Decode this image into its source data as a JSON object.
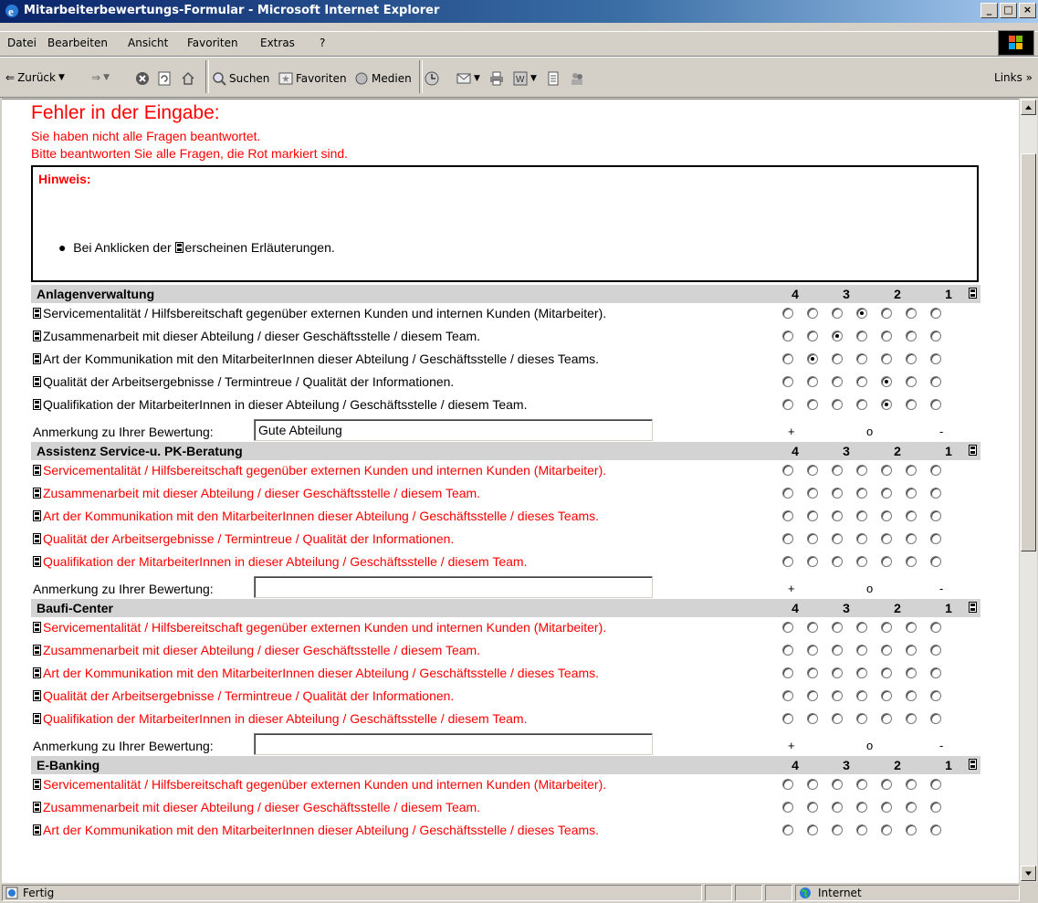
{
  "window": {
    "title": "Mitarbeiterbewertungs-Formular - Microsoft Internet Explorer",
    "min": "_",
    "max": "□",
    "close": "×"
  },
  "menu": [
    "Datei",
    "Bearbeiten",
    "Ansicht",
    "Favoriten",
    "Extras",
    "?"
  ],
  "toolbar": {
    "back": "Zurück",
    "search": "Suchen",
    "favorites": "Favoriten",
    "media": "Medien",
    "links": "Links"
  },
  "error": {
    "title": "Fehler in der Eingabe:",
    "line1": "Sie haben nicht alle Fragen beantwortet.",
    "line2": "Bitte beantworten Sie alle Fragen, die Rot markiert sind."
  },
  "hint": {
    "title": "Hinweis:",
    "bullet_pre": "Bei Anklicken der",
    "bullet_post": "erscheinen Erläuterungen."
  },
  "scale": [
    "4",
    "3",
    "2",
    "1"
  ],
  "remark": {
    "label": "Anmerkung zu Ihrer Bewertung:",
    "plus": "+",
    "zero": "o",
    "minus": "-"
  },
  "sections": [
    {
      "name": "Anlagenverwaltung",
      "remark_value": "Gute Abteilung",
      "questions": [
        {
          "text": "Servicementalität / Hilfsbereitschaft gegenüber externen Kunden und internen Kunden (Mitarbeiter).",
          "missing": false,
          "selected": 3
        },
        {
          "text": "Zusammenarbeit mit dieser Abteilung / dieser Geschäftsstelle / diesem Team.",
          "missing": false,
          "selected": 2
        },
        {
          "text": "Art der Kommunikation mit den MitarbeiterInnen dieser Abteilung / Geschäftsstelle / dieses Teams.",
          "missing": false,
          "selected": 1
        },
        {
          "text": "Qualität der Arbeitsergebnisse / Termintreue / Qualität der Informationen.",
          "missing": false,
          "selected": 4
        },
        {
          "text": "Qualifikation der MitarbeiterInnen in dieser Abteilung / Geschäftsstelle / diesem Team.",
          "missing": false,
          "selected": 4
        }
      ]
    },
    {
      "name": "Assistenz Service-u. PK-Beratung",
      "remark_value": "",
      "questions": [
        {
          "text": "Servicementalität / Hilfsbereitschaft gegenüber externen Kunden und internen Kunden (Mitarbeiter).",
          "missing": true,
          "selected": -1
        },
        {
          "text": "Zusammenarbeit mit dieser Abteilung / dieser Geschäftsstelle / diesem Team.",
          "missing": true,
          "selected": -1
        },
        {
          "text": "Art der Kommunikation mit den MitarbeiterInnen dieser Abteilung / Geschäftsstelle / dieses Teams.",
          "missing": true,
          "selected": -1
        },
        {
          "text": "Qualität der Arbeitsergebnisse / Termintreue / Qualität der Informationen.",
          "missing": true,
          "selected": -1
        },
        {
          "text": "Qualifikation der MitarbeiterInnen in dieser Abteilung / Geschäftsstelle / diesem Team.",
          "missing": true,
          "selected": -1
        }
      ]
    },
    {
      "name": "Baufi-Center",
      "remark_value": "",
      "questions": [
        {
          "text": "Servicementalität / Hilfsbereitschaft gegenüber externen Kunden und internen Kunden (Mitarbeiter).",
          "missing": true,
          "selected": -1
        },
        {
          "text": "Zusammenarbeit mit dieser Abteilung / dieser Geschäftsstelle / diesem Team.",
          "missing": true,
          "selected": -1
        },
        {
          "text": "Art der Kommunikation mit den MitarbeiterInnen dieser Abteilung / Geschäftsstelle / dieses Teams.",
          "missing": true,
          "selected": -1
        },
        {
          "text": "Qualität der Arbeitsergebnisse / Termintreue / Qualität der Informationen.",
          "missing": true,
          "selected": -1
        },
        {
          "text": "Qualifikation der MitarbeiterInnen in dieser Abteilung / Geschäftsstelle / diesem Team.",
          "missing": true,
          "selected": -1
        }
      ]
    },
    {
      "name": "E-Banking",
      "remark_value": "",
      "questions": [
        {
          "text": "Servicementalität / Hilfsbereitschaft gegenüber externen Kunden und internen Kunden (Mitarbeiter).",
          "missing": true,
          "selected": -1
        },
        {
          "text": "Zusammenarbeit mit dieser Abteilung / dieser Geschäftsstelle / diesem Team.",
          "missing": true,
          "selected": -1
        },
        {
          "text": "Art der Kommunikation mit den MitarbeiterInnen dieser Abteilung / Geschäftsstelle / dieses Teams.",
          "missing": true,
          "selected": -1
        }
      ]
    }
  ],
  "status": {
    "text": "Fertig",
    "zone": "Internet"
  },
  "colors": {
    "error": "#ff0000",
    "header_bg": "#d3d3d3",
    "chrome": "#d4d0c8"
  }
}
